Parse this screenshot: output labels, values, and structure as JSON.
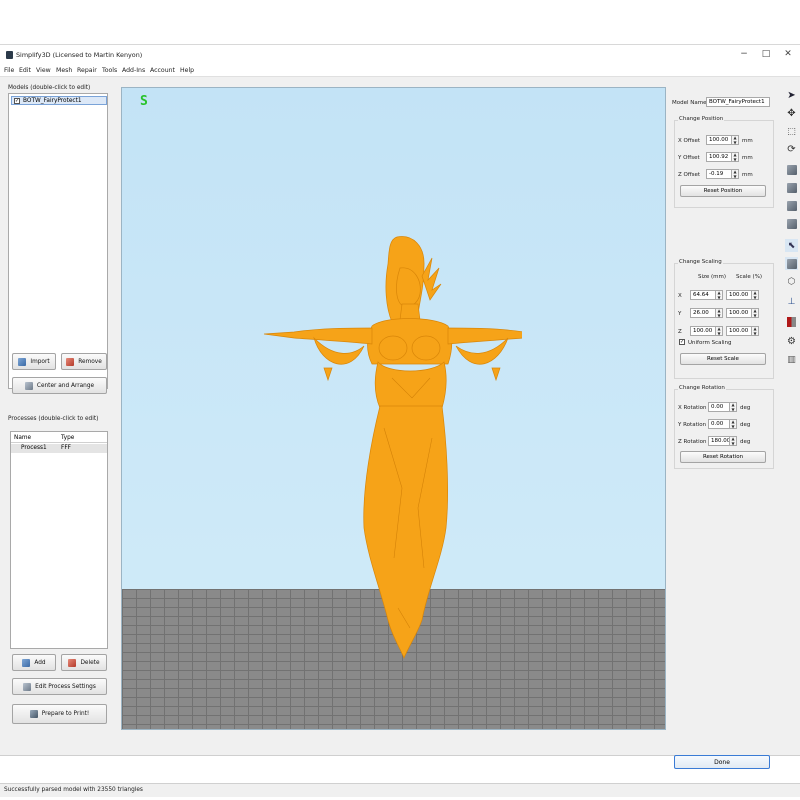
{
  "window": {
    "title": "Simplify3D (Licensed to Martin Kenyon)",
    "controls": {
      "minimize": "−",
      "maximize": "□",
      "close": "✕"
    }
  },
  "menu": [
    "File",
    "Edit",
    "View",
    "Mesh",
    "Repair",
    "Tools",
    "Add-Ins",
    "Account",
    "Help"
  ],
  "models_panel": {
    "label": "Models (double-click to edit)",
    "items": [
      {
        "name": "BOTW_FairyProtect1",
        "checked": true
      }
    ],
    "import_label": "Import",
    "remove_label": "Remove",
    "center_arrange_label": "Center and Arrange"
  },
  "processes_panel": {
    "label": "Processes (double-click to edit)",
    "columns": [
      "Name",
      "Type"
    ],
    "rows": [
      {
        "name": "Process1",
        "type": "FFF"
      }
    ],
    "add_label": "Add",
    "delete_label": "Delete",
    "edit_settings_label": "Edit Process Settings",
    "prepare_label": "Prepare to Print!"
  },
  "viewport": {
    "view_indicator": "S",
    "background_color": "#c9e7f8",
    "floor_color": "#8a8a8a",
    "model_color": "#f6a318"
  },
  "properties": {
    "model_name_label": "Model Name:",
    "model_name_value": "BOTW_FairyProtect1",
    "position": {
      "title": "Change Position",
      "x_label": "X Offset",
      "x_value": "100.00",
      "y_label": "Y Offset",
      "y_value": "100.92",
      "z_label": "Z Offset",
      "z_value": "-0.19",
      "unit": "mm",
      "reset_label": "Reset Position"
    },
    "scaling": {
      "title": "Change Scaling",
      "size_header": "Size (mm)",
      "scale_header": "Scale (%)",
      "rows": [
        {
          "axis": "X",
          "size": "64.64",
          "scale": "100.00"
        },
        {
          "axis": "Y",
          "size": "26.00",
          "scale": "100.00"
        },
        {
          "axis": "Z",
          "size": "100.00",
          "scale": "100.00"
        }
      ],
      "uniform_label": "Uniform Scaling",
      "uniform_checked": true,
      "reset_label": "Reset Scale"
    },
    "rotation": {
      "title": "Change Rotation",
      "x_label": "X Rotation",
      "x_value": "0.00",
      "y_label": "Y Rotation",
      "y_value": "0.00",
      "z_label": "Z Rotation",
      "z_value": "180.00",
      "unit": "deg",
      "reset_label": "Reset Rotation"
    },
    "done_label": "Done"
  },
  "toolbar_icons": [
    "select-arrow-icon",
    "move-icon",
    "scale-icon",
    "rotate-icon",
    "view-default-icon",
    "view-front-icon",
    "view-side-icon",
    "view-top-icon",
    "cursor-select-icon",
    "solid-view-icon",
    "wireframe-view-icon",
    "place-on-bed-icon",
    "cross-section-icon",
    "settings-gear-icon",
    "preview-icon"
  ],
  "status": {
    "text": "Successfully parsed model with 23550 triangles"
  }
}
